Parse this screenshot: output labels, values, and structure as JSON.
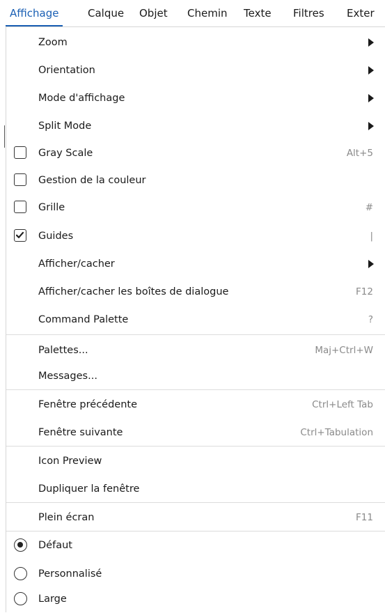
{
  "menubar": {
    "items": [
      "Affichage",
      "Calque",
      "Objet",
      "Chemin",
      "Texte",
      "Filtres",
      "Exter"
    ]
  },
  "menu": {
    "zoom": "Zoom",
    "orientation": "Orientation",
    "display_mode": "Mode d'affichage",
    "split_mode": "Split Mode",
    "gray_scale": {
      "label": "Gray Scale",
      "shortcut": "Alt+5",
      "checked": false
    },
    "color_management": {
      "label": "Gestion de la couleur",
      "checked": false
    },
    "grid": {
      "label": "Grille",
      "shortcut": "#",
      "checked": false
    },
    "guides": {
      "label": "Guides",
      "shortcut": "|",
      "checked": true
    },
    "show_hide": "Afficher/cacher",
    "show_hide_dialogs": {
      "label": "Afficher/cacher les boîtes de dialogue",
      "shortcut": "F12"
    },
    "command_palette": {
      "label": "Command Palette",
      "shortcut": "?"
    },
    "palettes": {
      "label": "Palettes...",
      "shortcut": "Maj+Ctrl+W"
    },
    "messages": "Messages...",
    "previous_window": {
      "label": "Fenêtre précédente",
      "shortcut": "Ctrl+Left Tab"
    },
    "next_window": {
      "label": "Fenêtre suivante",
      "shortcut": "Ctrl+Tabulation"
    },
    "icon_preview": "Icon Preview",
    "duplicate_window": "Dupliquer la fenêtre",
    "fullscreen": {
      "label": "Plein écran",
      "shortcut": "F11"
    },
    "theme_options": [
      {
        "label": "Défaut",
        "selected": true
      },
      {
        "label": "Personnalisé",
        "selected": false
      },
      {
        "label": "Large",
        "selected": false
      }
    ]
  },
  "colors": {
    "accent": "#1a5fb4",
    "text": "#1a1a1a",
    "shortcut": "#8a8a8a",
    "separator": "#dcdcdc"
  }
}
